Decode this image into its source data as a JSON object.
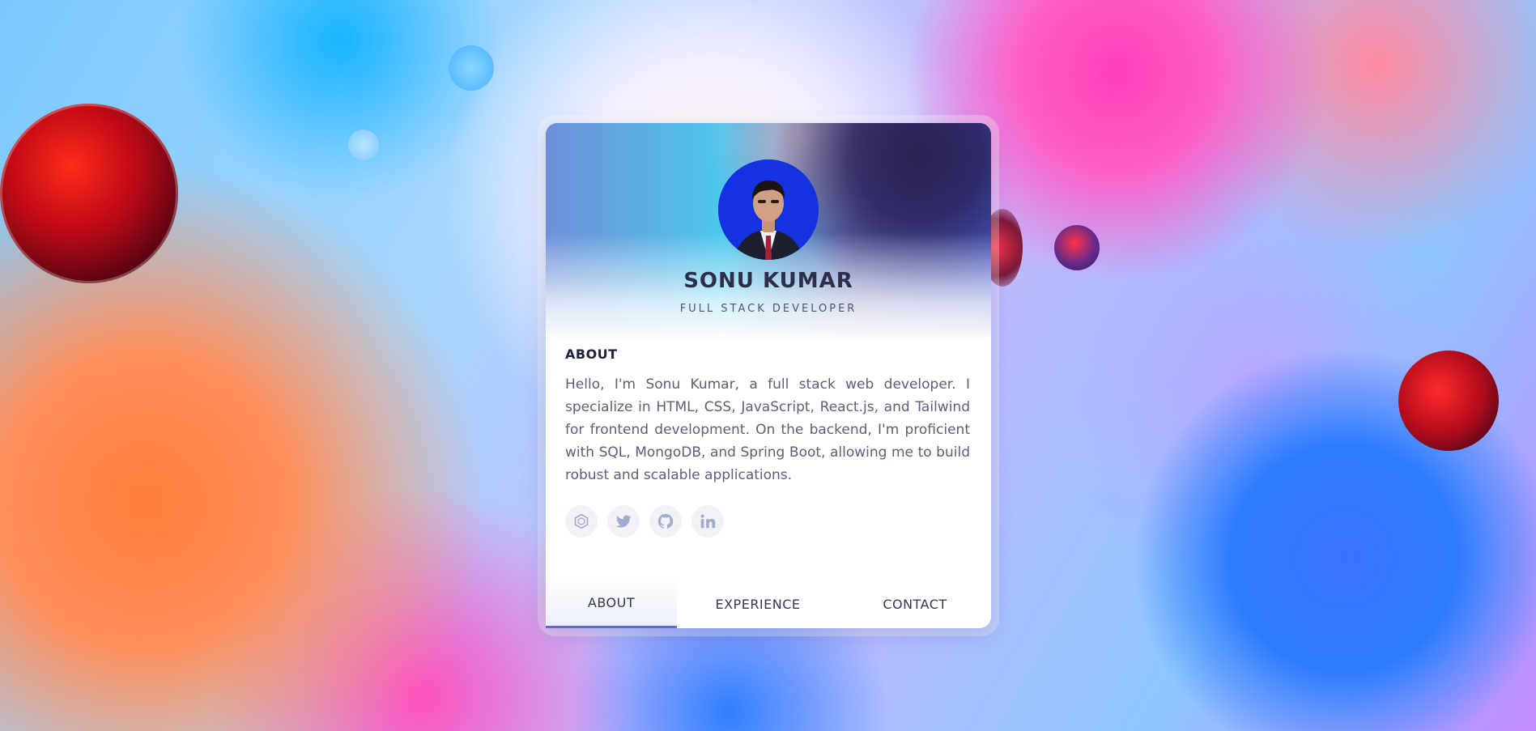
{
  "profile": {
    "name": "SONU KUMAR",
    "role": "FULL STACK DEVELOPER"
  },
  "about": {
    "title": "ABOUT",
    "text": "Hello, I'm Sonu Kumar, a full stack web developer. I specialize in HTML, CSS, JavaScript, React.js, and Tailwind for frontend development. On the backend, I'm proficient with SQL, MongoDB, and Spring Boot, allowing me to build robust and scalable applications."
  },
  "socials": [
    {
      "icon": "hexagon-icon"
    },
    {
      "icon": "twitter-icon"
    },
    {
      "icon": "github-icon"
    },
    {
      "icon": "linkedin-icon"
    }
  ],
  "tabs": [
    {
      "label": "ABOUT",
      "active": true
    },
    {
      "label": "EXPERIENCE",
      "active": false
    },
    {
      "label": "CONTACT",
      "active": false
    }
  ],
  "colors": {
    "accent": "#5f6ad6",
    "icon": "#a3abcc",
    "text_dark": "#1e2238",
    "text_body": "#5b6074"
  }
}
